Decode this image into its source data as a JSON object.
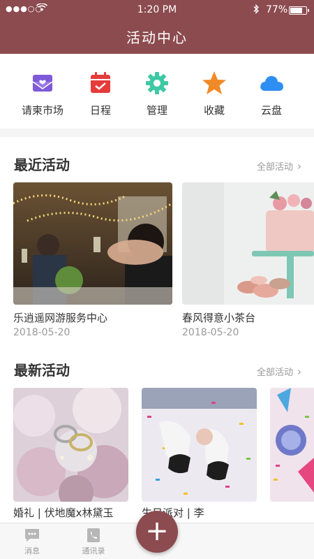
{
  "status_bar": {
    "carrier": "●●●○○",
    "time": "1:20 PM",
    "battery": "77%",
    "battery_level": 0.77
  },
  "header": {
    "title": "活动中心"
  },
  "quick_actions": [
    {
      "label": "请柬市场",
      "icon": "envelope-heart-icon",
      "color": "#7e5ad9"
    },
    {
      "label": "日程",
      "icon": "calendar-check-icon",
      "color": "#e53b3b"
    },
    {
      "label": "管理",
      "icon": "gear-icon",
      "color": "#3ec9a4"
    },
    {
      "label": "收藏",
      "icon": "star-icon",
      "color": "#f08a28"
    },
    {
      "label": "云盘",
      "icon": "cloud-icon",
      "color": "#2f8ef2"
    }
  ],
  "recent": {
    "title": "最近活动",
    "more": "全部活动",
    "cards": [
      {
        "name": "乐逍遥网游服务中心",
        "date": "2018-05-20",
        "image": "party-toast-photo"
      },
      {
        "name": "春风得意小茶台",
        "date": "2018-05-20",
        "image": "cake-photo"
      }
    ]
  },
  "latest": {
    "title": "最新活动",
    "more": "全部活动",
    "cards": [
      {
        "name": "婚礼 | 伏地魔x林黛玉",
        "image": "wedding-rings-photo"
      },
      {
        "name": "生日派对 | 李",
        "image": "confetti-shoes-photo"
      },
      {
        "name": "",
        "image": "party-decor-photo"
      }
    ]
  },
  "tabbar": {
    "messages": "消息",
    "contacts": "通讯录",
    "add": "+"
  }
}
